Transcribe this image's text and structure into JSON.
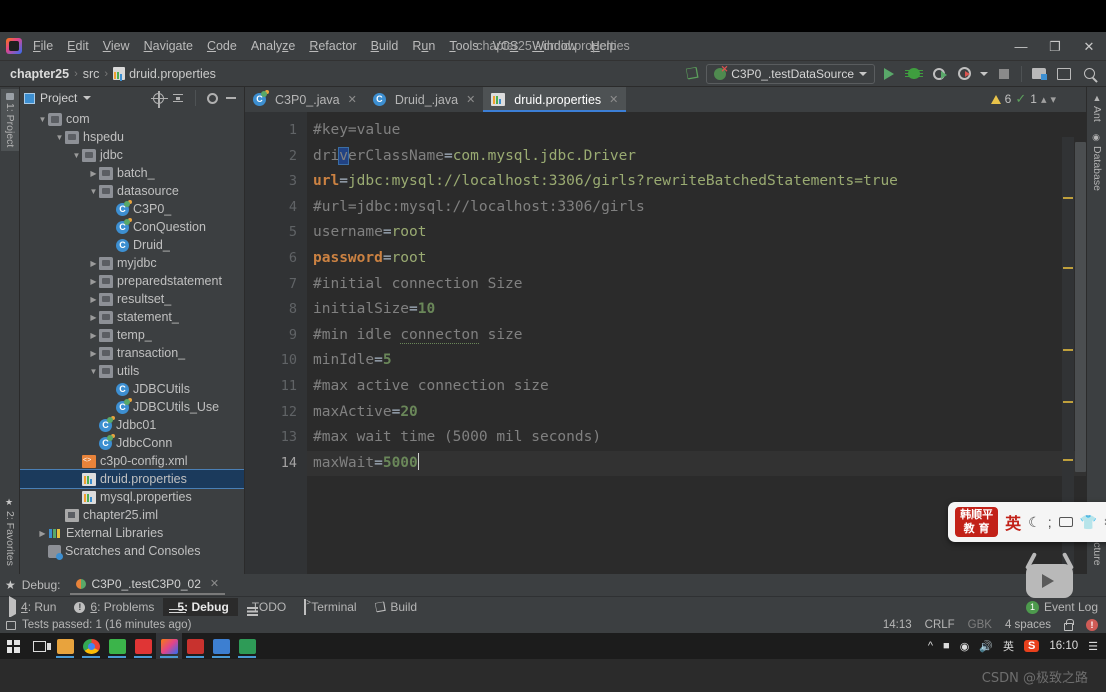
{
  "window": {
    "title": "chapter25 - druid.properties",
    "controls": {
      "minimize": "—",
      "maximize": "❐",
      "close": "✕"
    }
  },
  "menubar": {
    "items": [
      {
        "label": "File",
        "mnemonic": "F"
      },
      {
        "label": "Edit",
        "mnemonic": "E"
      },
      {
        "label": "View",
        "mnemonic": "V"
      },
      {
        "label": "Navigate",
        "mnemonic": "N"
      },
      {
        "label": "Code",
        "mnemonic": "C"
      },
      {
        "label": "Analyze",
        "mnemonic": "z"
      },
      {
        "label": "Refactor",
        "mnemonic": "R"
      },
      {
        "label": "Build",
        "mnemonic": "B"
      },
      {
        "label": "Run",
        "mnemonic": "u"
      },
      {
        "label": "Tools",
        "mnemonic": "T"
      },
      {
        "label": "VCS",
        "mnemonic": "S"
      },
      {
        "label": "Window",
        "mnemonic": "W"
      },
      {
        "label": "Help",
        "mnemonic": "H"
      }
    ]
  },
  "navbar": {
    "breadcrumb": [
      "chapter25",
      "src",
      "druid.properties"
    ],
    "separator": "›",
    "run_config": "C3P0_.testDataSource",
    "buttons": {
      "build": "build-hammer",
      "run": "Run",
      "debug": "Debug",
      "run_coverage": "Run with Coverage",
      "profiler": "Profiler",
      "stop": "Stop",
      "project_structure": "Project Structure",
      "settings": "Settings",
      "search": "Search Everywhere"
    }
  },
  "left_strip": {
    "tabs": [
      {
        "label": "1: Project",
        "active": true
      },
      {
        "label": "2: Favorites",
        "active": false
      }
    ]
  },
  "right_strip": {
    "tabs": [
      {
        "label": "Ant"
      },
      {
        "label": "Database"
      },
      {
        "label": "Structure"
      }
    ]
  },
  "project_panel": {
    "title": "Project",
    "tree": [
      {
        "label": "com",
        "indent": 1,
        "arrow": "v",
        "icon": "module",
        "selected": false
      },
      {
        "label": "hspedu",
        "indent": 2,
        "arrow": "v",
        "icon": "pkg",
        "selected": false
      },
      {
        "label": "jdbc",
        "indent": 3,
        "arrow": "v",
        "icon": "pkg",
        "selected": false
      },
      {
        "label": "batch_",
        "indent": 4,
        "arrow": ">",
        "icon": "pkg",
        "selected": false
      },
      {
        "label": "datasource",
        "indent": 4,
        "arrow": "v",
        "icon": "pkg",
        "selected": false
      },
      {
        "label": "C3P0_",
        "indent": 5,
        "arrow": "",
        "icon": "class-run",
        "selected": false
      },
      {
        "label": "ConQuestion",
        "indent": 5,
        "arrow": "",
        "icon": "class-run",
        "selected": false
      },
      {
        "label": "Druid_",
        "indent": 5,
        "arrow": "",
        "icon": "class",
        "selected": false
      },
      {
        "label": "myjdbc",
        "indent": 4,
        "arrow": ">",
        "icon": "pkg",
        "selected": false
      },
      {
        "label": "preparedstatement",
        "indent": 4,
        "arrow": ">",
        "icon": "pkg",
        "selected": false
      },
      {
        "label": "resultset_",
        "indent": 4,
        "arrow": ">",
        "icon": "pkg",
        "selected": false
      },
      {
        "label": "statement_",
        "indent": 4,
        "arrow": ">",
        "icon": "pkg",
        "selected": false
      },
      {
        "label": "temp_",
        "indent": 4,
        "arrow": ">",
        "icon": "pkg",
        "selected": false
      },
      {
        "label": "transaction_",
        "indent": 4,
        "arrow": ">",
        "icon": "pkg",
        "selected": false
      },
      {
        "label": "utils",
        "indent": 4,
        "arrow": "v",
        "icon": "pkg",
        "selected": false
      },
      {
        "label": "JDBCUtils",
        "indent": 5,
        "arrow": "",
        "icon": "class",
        "selected": false
      },
      {
        "label": "JDBCUtils_Use",
        "indent": 5,
        "arrow": "",
        "icon": "class-run",
        "selected": false
      },
      {
        "label": "Jdbc01",
        "indent": 4,
        "arrow": "",
        "icon": "class-run",
        "selected": false
      },
      {
        "label": "JdbcConn",
        "indent": 4,
        "arrow": "",
        "icon": "class-run",
        "selected": false
      },
      {
        "label": "c3p0-config.xml",
        "indent": 3,
        "arrow": "",
        "icon": "xml",
        "selected": false
      },
      {
        "label": "druid.properties",
        "indent": 3,
        "arrow": "",
        "icon": "prop",
        "selected": true
      },
      {
        "label": "mysql.properties",
        "indent": 3,
        "arrow": "",
        "icon": "prop",
        "selected": false
      },
      {
        "label": "chapter25.iml",
        "indent": 2,
        "arrow": "",
        "icon": "iml",
        "selected": false
      },
      {
        "label": "External Libraries",
        "indent": 1,
        "arrow": ">",
        "icon": "lib",
        "selected": false
      },
      {
        "label": "Scratches and Consoles",
        "indent": 1,
        "arrow": "",
        "icon": "scratch",
        "selected": false
      }
    ]
  },
  "editor": {
    "tabs": [
      {
        "label": "C3P0_.java",
        "icon": "class-run",
        "active": false,
        "closable": true
      },
      {
        "label": "Druid_.java",
        "icon": "class",
        "active": false,
        "closable": true
      },
      {
        "label": "druid.properties",
        "icon": "prop",
        "active": true,
        "closable": true
      }
    ],
    "inspections": {
      "warnings": "6",
      "checks": "1"
    },
    "lines": [
      {
        "n": "1",
        "text": "#key=value"
      },
      {
        "n": "2",
        "text": "driverClassName=com.mysql.jdbc.Driver"
      },
      {
        "n": "3",
        "text": "url=jdbc:mysql://localhost:3306/girls?rewriteBatchedStatements=true"
      },
      {
        "n": "4",
        "text": "#url=jdbc:mysql://localhost:3306/girls"
      },
      {
        "n": "5",
        "text": "username=root"
      },
      {
        "n": "6",
        "text": "password=root"
      },
      {
        "n": "7",
        "text": "#initial connection Size"
      },
      {
        "n": "8",
        "text": "initialSize=10"
      },
      {
        "n": "9",
        "text": "#min idle connecton size"
      },
      {
        "n": "10",
        "text": "minIdle=5"
      },
      {
        "n": "11",
        "text": "#max active connection size"
      },
      {
        "n": "12",
        "text": "maxActive=20"
      },
      {
        "n": "13",
        "text": "#max wait time (5000 mil seconds)"
      },
      {
        "n": "14",
        "text": "maxWait=5000"
      }
    ]
  },
  "debug_window": {
    "label": "Debug:",
    "session": "C3P0_.testC3P0_02"
  },
  "tool_windows": {
    "items": [
      {
        "label": "4: Run",
        "mnemonic": "4",
        "rest": ": Run",
        "icon": "run-icon",
        "active": false
      },
      {
        "label": "6: Problems",
        "mnemonic": "6",
        "rest": ": Problems",
        "icon": "problems-icon",
        "active": false
      },
      {
        "label": "5: Debug",
        "mnemonic": "5",
        "rest": ": Debug",
        "icon": "debug-icon",
        "active": true
      },
      {
        "label": "TODO",
        "mnemonic": "",
        "rest": "TODO",
        "icon": "todo-icon",
        "active": false
      },
      {
        "label": "Terminal",
        "mnemonic": "",
        "rest": "Terminal",
        "icon": "terminal-icon",
        "active": false
      },
      {
        "label": "Build",
        "mnemonic": "",
        "rest": "Build",
        "icon": "build-icon",
        "active": false
      }
    ],
    "event_log": {
      "label": "Event Log",
      "badge": "1"
    }
  },
  "status_bar": {
    "message": "Tests passed: 1 (16 minutes ago)",
    "caret": "14:13",
    "line_sep": "CRLF",
    "encoding": "GBK",
    "indent": "4 spaces",
    "lock": "lock-icon",
    "error": "!"
  },
  "taskbar": {
    "items": [
      {
        "name": "start-button",
        "glyph": "windows"
      },
      {
        "name": "task-view",
        "glyph": "taskview"
      },
      {
        "name": "file-explorer",
        "color": "#e8a33d"
      },
      {
        "name": "chrome",
        "color": "#4285f4"
      },
      {
        "name": "wechat",
        "color": "#3bb44a"
      },
      {
        "name": "xmind",
        "color": "#e03535"
      },
      {
        "name": "intellij-idea",
        "color": "#e1448b"
      },
      {
        "name": "wps-writer",
        "color": "#c8322e"
      },
      {
        "name": "help-app",
        "color": "#3d7fd1"
      },
      {
        "name": "notepad-app",
        "color": "#2e9b57"
      }
    ],
    "tray": {
      "chevron": "^",
      "icons": [
        "battery-icon",
        "wifi-icon",
        "volume-icon"
      ],
      "ime": "英",
      "sogou": "S",
      "time": "16:10",
      "notifications": "notification-icon"
    }
  },
  "ime_bar": {
    "logo_line1": "韩顺平",
    "logo_line2": "教 育",
    "mode": "英",
    "icons": [
      "moon-icon",
      "semicolon-icon",
      "keyboard-icon",
      "skin-icon",
      "tools-icon"
    ]
  },
  "watermark": "CSDN @极致之路"
}
